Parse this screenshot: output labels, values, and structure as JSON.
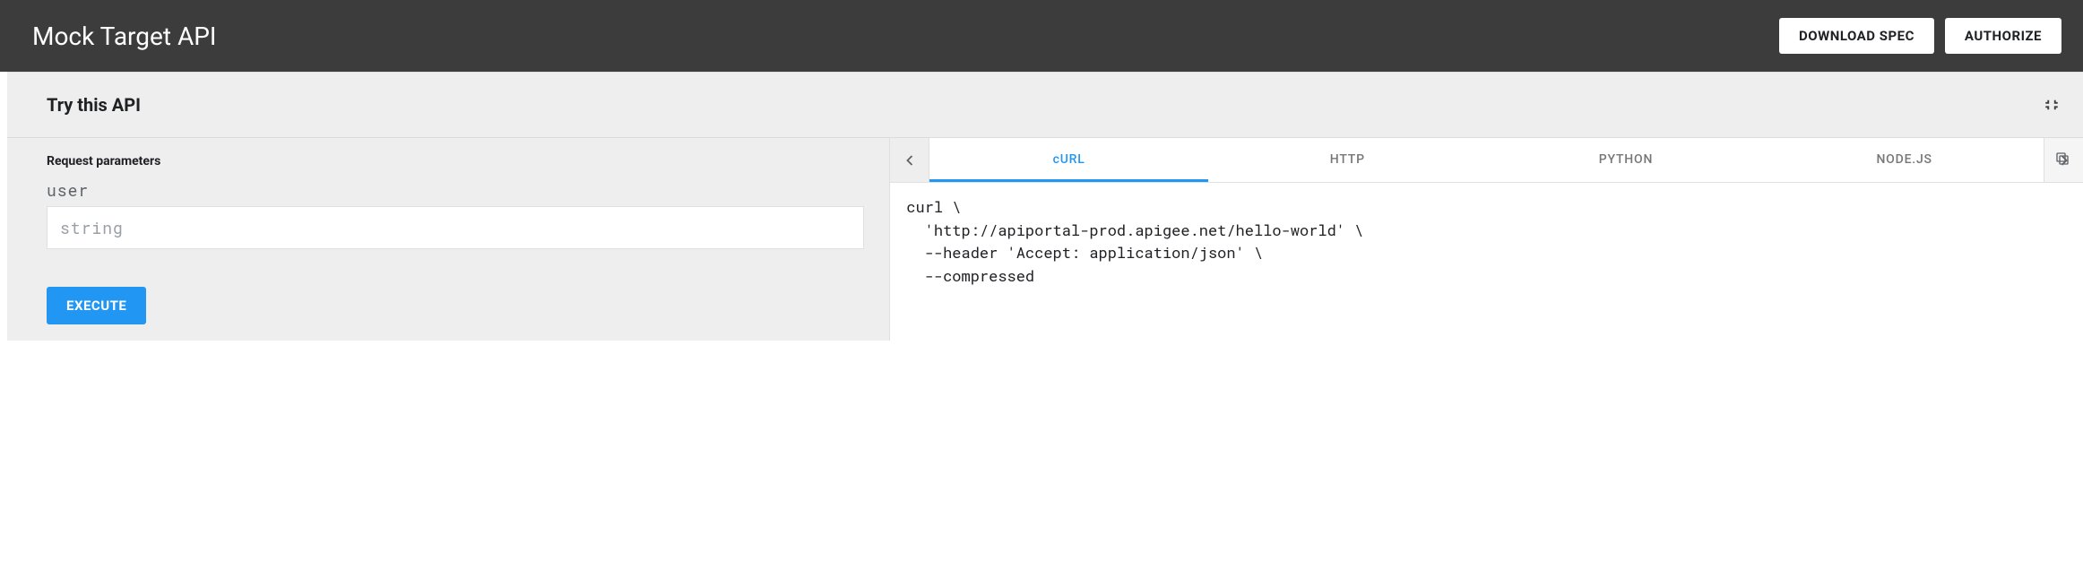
{
  "header": {
    "title": "Mock Target API",
    "download_label": "DOWNLOAD SPEC",
    "authorize_label": "AUTHORIZE"
  },
  "panel": {
    "title": "Try this API",
    "request_params_label": "Request parameters",
    "params": [
      {
        "name": "user",
        "placeholder": "string",
        "value": ""
      }
    ],
    "execute_label": "EXECUTE"
  },
  "code": {
    "tabs": [
      "cURL",
      "HTTP",
      "PYTHON",
      "NODE.JS"
    ],
    "active_index": 0,
    "snippet": "curl \\\n  'http://apiportal-prod.apigee.net/hello-world' \\\n  --header 'Accept: application/json' \\\n  --compressed"
  }
}
